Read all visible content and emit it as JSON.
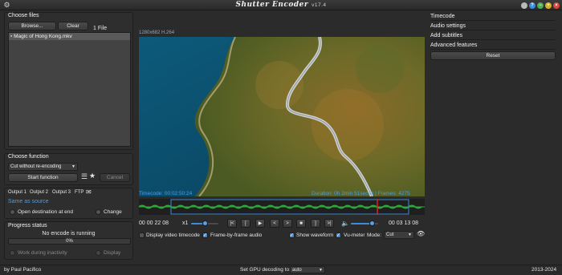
{
  "app": {
    "title": "Shutter Encoder",
    "version": "v17.4",
    "author": "by Paul Pacifico",
    "years": "2013-2024"
  },
  "window_buttons": [
    {
      "name": "minimize",
      "color": "#b9b9b9",
      "glyph": ""
    },
    {
      "name": "help",
      "color": "#3c8bd8",
      "glyph": "?"
    },
    {
      "name": "info",
      "color": "#4caf50",
      "glyph": ""
    },
    {
      "name": "maximize",
      "color": "#d4b02a",
      "glyph": ""
    },
    {
      "name": "close",
      "color": "#d9463a",
      "glyph": ""
    }
  ],
  "files": {
    "title": "Choose files",
    "browse_label": "Browse...",
    "clear_label": "Clear",
    "count_label": "1 File",
    "items": [
      "Magic of Hong Kong.mkv"
    ]
  },
  "function": {
    "title": "Choose function",
    "selected": "Cut without re-encoding",
    "start_label": "Start function",
    "cancel_label": "Cancel"
  },
  "output": {
    "tabs": [
      "Output 1",
      "Output 2",
      "Output 3",
      "FTP"
    ],
    "same_as_source": "Same as source",
    "open_dest": "Open destination at end",
    "change_label": "Change"
  },
  "progress": {
    "title": "Progress status",
    "status": "No encode is running",
    "percent": "0%",
    "work_inactivity": "Work during inactivity",
    "display_label": "Display"
  },
  "player": {
    "resolution": "1280x682 H.264",
    "timecode": "Timecode: 00:02:50:24",
    "duration": "Duration: 0h 2min 51sec 0i | Frames: 4275",
    "in_time": "00 00 22 08",
    "out_time": "00 03 13 08",
    "speed": "x1",
    "controls": [
      "|<",
      "[",
      "▶",
      "<",
      ">",
      "■",
      "]",
      ">|"
    ],
    "options": {
      "display_timecode": "Display video timecode",
      "frame_audio": "Frame-by-frame audio",
      "show_waveform": "Show waveform",
      "vu_meter": "Vu-meter",
      "mode_label": "Mode:",
      "mode_value": "Cut"
    }
  },
  "right_panel": {
    "items": [
      "Timecode",
      "Audio settings",
      "Add subtitles",
      "Advanced features"
    ],
    "reset_label": "Reset"
  },
  "footer": {
    "gpu_label": "Set GPU decoding to:",
    "gpu_value": "auto"
  },
  "colors": {
    "accent": "#3c8bd8",
    "waveform": "#2fa83a",
    "playhead": "#e02020",
    "hud": "#4d9de0"
  }
}
